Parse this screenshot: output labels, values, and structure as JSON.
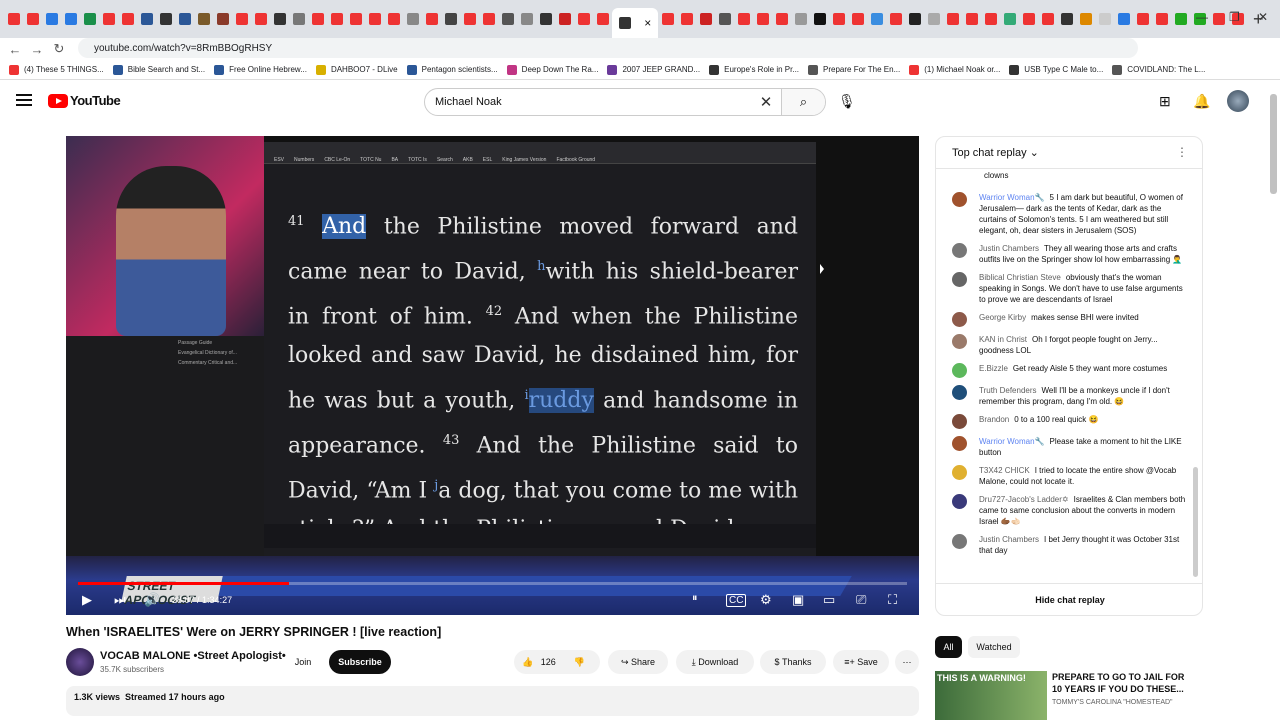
{
  "browser": {
    "tab_colors": [
      "#e33",
      "#e33",
      "#2a7ae2",
      "#2a7ae2",
      "#1a8f4a",
      "#e33",
      "#e33",
      "#2b5797",
      "#333",
      "#2b5797",
      "#7a5a2a",
      "#8a3a2a",
      "#e33",
      "#e33",
      "#333",
      "#777",
      "#e33",
      "#e33",
      "#e33",
      "#e33",
      "#e33",
      "#888",
      "#e33",
      "#444",
      "#e33",
      "#e33",
      "#555",
      "#888",
      "#333",
      "#c22",
      "#e33",
      "#e33",
      "#333",
      "#e33",
      "#e33",
      "#c22",
      "#555",
      "#e33",
      "#e33",
      "#e33",
      "#999",
      "#111",
      "#e33",
      "#e33",
      "#3a8de0",
      "#e33",
      "#222",
      "#aaa",
      "#e33",
      "#e33",
      "#e33",
      "#3a7",
      "#e33",
      "#e33",
      "#333",
      "#d80",
      "#ccc",
      "#2a7ae2",
      "#e33",
      "#e33",
      "#2a2",
      "#2a2",
      "#e33",
      "#e33"
    ],
    "active_tab_close": "×",
    "new_tab": "+",
    "window_controls": {
      "minimize": "—",
      "restore": "❐",
      "close": "✕"
    },
    "url": "youtube.com/watch?v=8RmBBOgRHSY",
    "back_icon": "←",
    "forward_icon": "→",
    "reload_icon": "↻"
  },
  "bookmarks": [
    {
      "label": "(4) These 5 THINGS...",
      "color": "#e33"
    },
    {
      "label": "Bible Search and St...",
      "color": "#2b5797"
    },
    {
      "label": "Free Online Hebrew...",
      "color": "#2b5797"
    },
    {
      "label": "DAHBOO7 - DLive",
      "color": "#d8b000"
    },
    {
      "label": "Pentagon scientists...",
      "color": "#2b5797"
    },
    {
      "label": "Deep Down The Ra...",
      "color": "#c13584"
    },
    {
      "label": "2007 JEEP GRAND...",
      "color": "#6a3a9a"
    },
    {
      "label": "Europe's Role in Pr...",
      "color": "#333"
    },
    {
      "label": "Prepare For The En...",
      "color": "#555"
    },
    {
      "label": "(1) Michael Noak or...",
      "color": "#e33"
    },
    {
      "label": "USB Type C Male to...",
      "color": "#333"
    },
    {
      "label": "COVIDLAND: The L...",
      "color": "#555"
    }
  ],
  "youtube_header": {
    "logo_text": "YouTube",
    "search_query": "Michael Noak",
    "clear_icon": "✕",
    "search_icon": "⌕",
    "mic_icon": "🎙"
  },
  "video": {
    "screen_tabs": [
      "ESV",
      "Numbers",
      "CBC Le-On",
      "TOTC Nu",
      "BA",
      "TOTC Is",
      "Search",
      "AKB",
      "ESL",
      "King James Version",
      "Factbook Ground"
    ],
    "sidebar_items": [
      "Passage Guide",
      "Evangelical Dictionary of...",
      "Commentary Critical and..."
    ],
    "verse_41": "41",
    "hl_and": "And",
    "text_1": " the Philistine moved forward and came near to David, ",
    "mark_h": "h",
    "text_2": "with his shield-bearer in front of him. ",
    "verse_42": "42",
    "text_3": " And when the Philistine looked and saw David, he disdained him, for he was but a youth, ",
    "mark_i": "i",
    "hl_ruddy": "ruddy",
    "text_4": " and handsome in appearance. ",
    "verse_43": "43",
    "text_5": " And the Philistine said to David, “Am ",
    "text_6": "I ",
    "mark_j": "j",
    "text_7": "a dog, that you come to me with sticks?” And the Philistine cursed David",
    "banner_logo": "STREET APOLOGIST",
    "time_current": "28:07",
    "time_total": "1:34:27",
    "progress": 0.254
  },
  "video_info": {
    "title": "When 'ISRAELITES' Were on JERRY SPRINGER ! [live reaction]",
    "channel": "VOCAB MALONE •Street Apologist•",
    "subscribers": "35.7K subscribers",
    "join": "Join",
    "subscribe": "Subscribe",
    "likes": "126",
    "share": "Share",
    "download": "Download",
    "thanks": "Thanks",
    "save": "Save",
    "views": "1.3K views",
    "streamed": "Streamed 17 hours ago"
  },
  "chat": {
    "header": "Top chat replay",
    "messages": [
      {
        "author": "",
        "text": "clowns",
        "color": "#ffffff",
        "mod": false
      },
      {
        "author": "Warrior Woman🔧",
        "text": "5 I am dark but beautiful, O women of Jerusalem— dark as the tents of Kedar, dark as the curtains of Solomon's tents. 5 I am weathered but still elegant, oh, dear sisters in Jerusalem (SOS)",
        "color": "#a0522d",
        "mod": true
      },
      {
        "author": "Justin Chambers",
        "text": "They all wearing those arts and crafts outfits live on the Springer show lol how embarrassing 🤦‍♂️",
        "color": "#777",
        "mod": false
      },
      {
        "author": "Biblical Christian Steve",
        "text": "obviously that's the woman speaking in Songs. We don't have to use false arguments to prove we are descendants of Israel",
        "color": "#666",
        "mod": false
      },
      {
        "author": "George Kirby",
        "text": "makes sense BHI were invited",
        "color": "#8d5a4a",
        "mod": false
      },
      {
        "author": "KAN in Christ",
        "text": "Oh I forgot people fought on Jerry... goodness LOL",
        "color": "#9a7a6a",
        "mod": false
      },
      {
        "author": "E.Bizzle",
        "text": "Get ready Aisle 5 they want more costumes",
        "color": "#5cb85c",
        "mod": false
      },
      {
        "author": "Truth Defenders",
        "text": "Well I'll be a monkeys uncle if I don't remember this program, dang I'm old. 😆",
        "color": "#1f4f7a",
        "mod": false
      },
      {
        "author": "Brandon",
        "text": "0 to a 100 real quick 😆",
        "color": "#7a4a3a",
        "mod": false
      },
      {
        "author": "Warrior Woman🔧",
        "text": "Please take a moment to hit the LIKE button",
        "color": "#a0522d",
        "mod": true
      },
      {
        "author": "T3X42 CHICK",
        "text": "I tried to locate the entire show @Vocab Malone, could not locate it.",
        "color": "#e0b030",
        "mod": false
      },
      {
        "author": "Dru727-Jacob's Ladder✡",
        "text": "Israelites & Clan members both came to same conclusion about the converts in modern Israel 🫱🏾🫲🏻",
        "color": "#3a3a7a",
        "mod": false
      },
      {
        "author": "Justin Chambers",
        "text": "I bet Jerry thought it was October 31st that day",
        "color": "#777",
        "mod": false
      }
    ],
    "hide": "Hide chat replay"
  },
  "related": {
    "chip_all": "All",
    "chip_watched": "Watched",
    "thumb_text": "THIS IS A WARNING!",
    "title": "PREPARE TO GO TO JAIL FOR 10 YEARS IF YOU DO THESE...",
    "channel": "TOMMY'S CAROLINA \"HOMESTEAD\""
  }
}
